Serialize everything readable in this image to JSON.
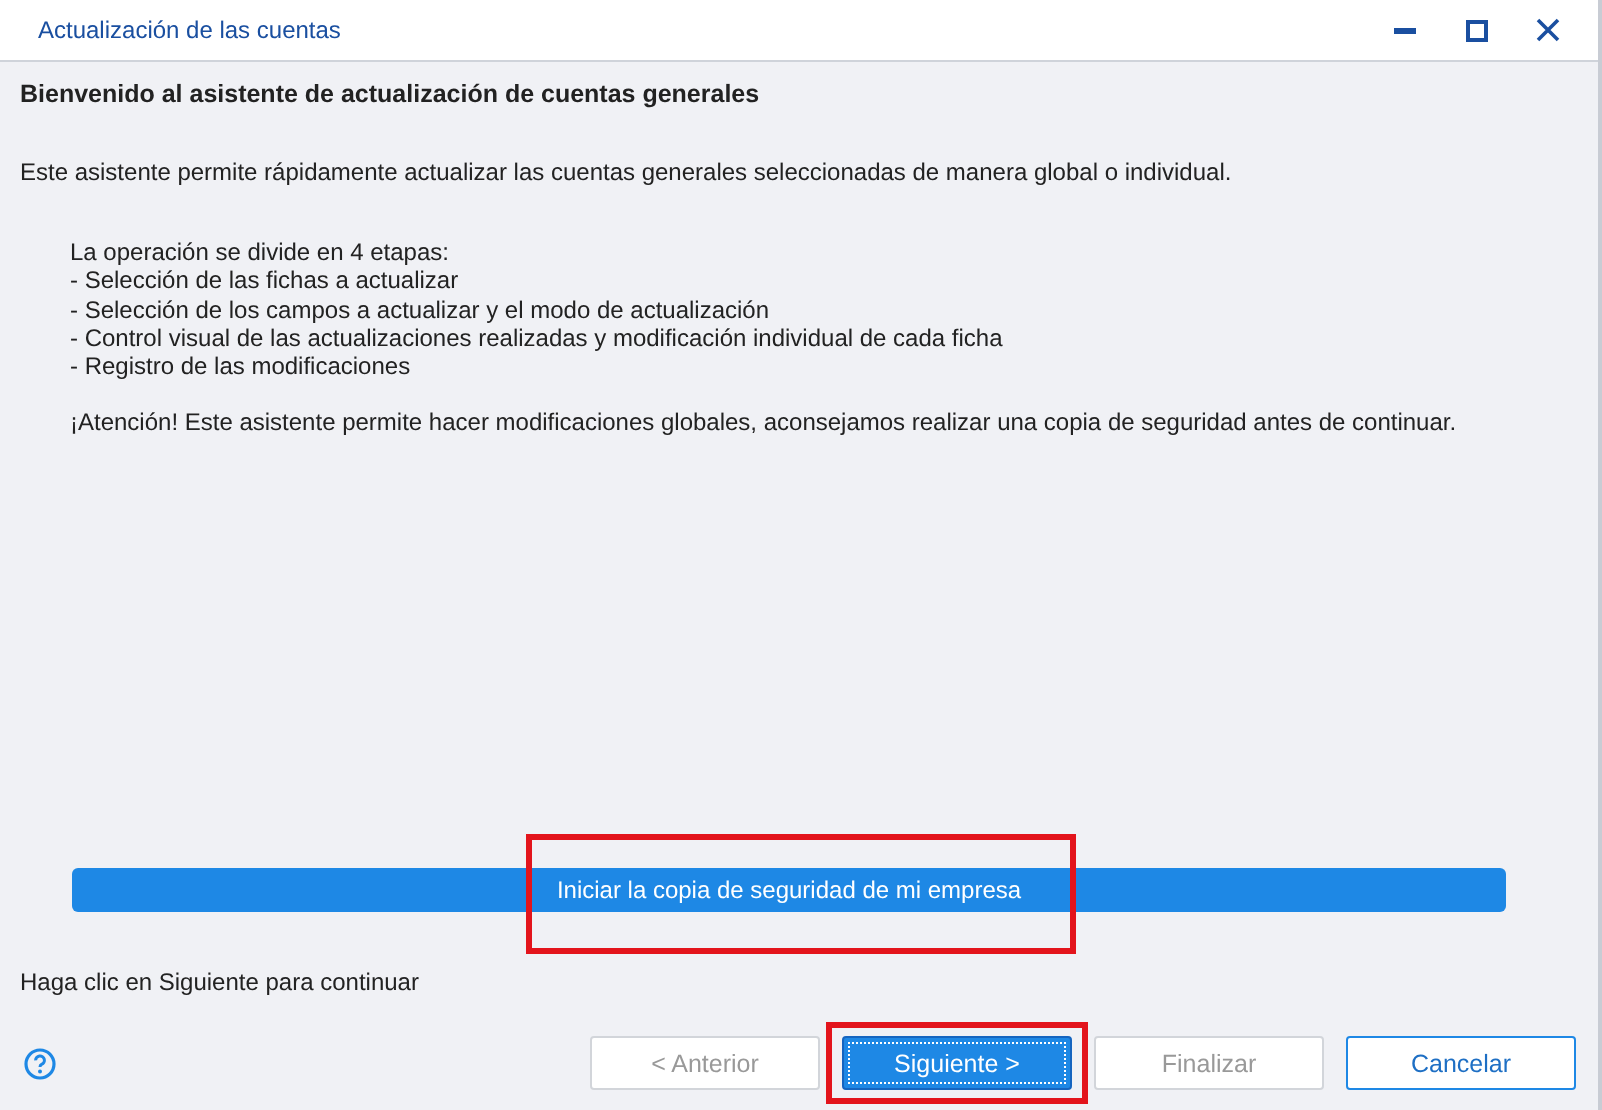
{
  "window": {
    "title": "Actualización de las cuentas"
  },
  "header": "Bienvenido al asistente de actualización de cuentas generales",
  "intro": "Este asistente permite rápidamente actualizar las cuentas generales seleccionadas de manera global o individual.",
  "steps_heading": "La operación se divide en 4 etapas:",
  "steps": [
    "- Selección de las fichas a actualizar",
    "- Selección de los campos a actualizar y el modo de actualización",
    "- Control visual de las actualizaciones realizadas y modificación individual de cada ficha",
    "- Registro de las modificaciones"
  ],
  "warning": "¡Atención! Este asistente permite hacer modificaciones globales, aconsejamos realizar una copia de seguridad antes de continuar.",
  "backup_button": {
    "label": "Iniciar la copia de seguridad de mi empresa",
    "highlighted": true
  },
  "hint": "Haga clic en Siguiente para continuar",
  "buttons": [
    {
      "label": "< Anterior",
      "kind": "secondary",
      "disabled": true,
      "highlighted": false
    },
    {
      "label": "Siguiente >",
      "kind": "primary",
      "disabled": false,
      "highlighted": true
    },
    {
      "label": "Finalizar",
      "kind": "secondary",
      "disabled": true,
      "highlighted": false
    },
    {
      "label": "Cancelar",
      "kind": "outlined",
      "disabled": false,
      "highlighted": false
    }
  ]
}
